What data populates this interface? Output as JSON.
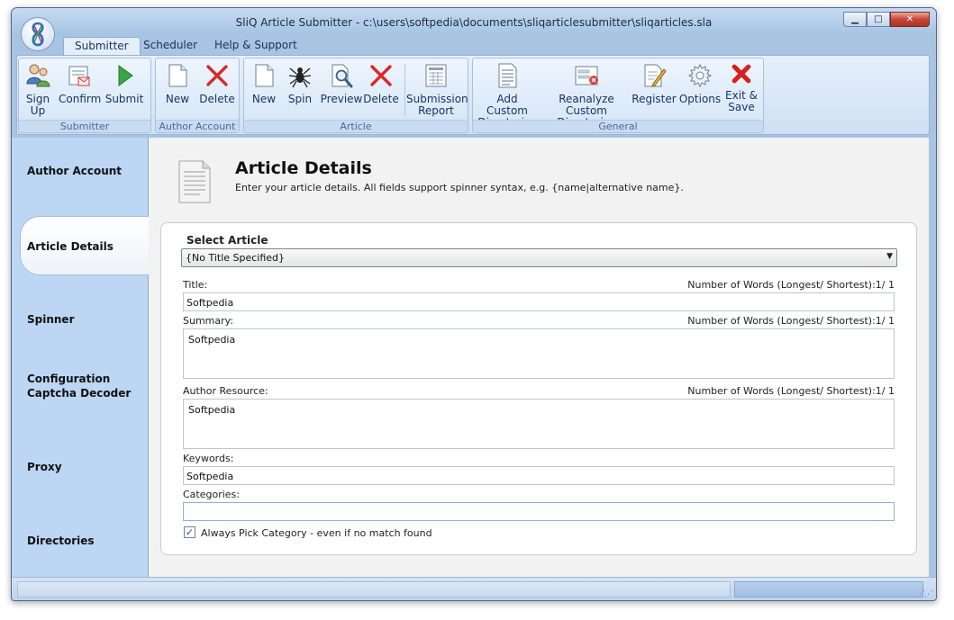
{
  "window": {
    "title": "SliQ Article Submitter - c:\\users\\softpedia\\documents\\sliqarticlesubmitter\\sliqarticles.sla",
    "min_glyph": "▁",
    "max_glyph": "□",
    "close_glyph": "✕"
  },
  "tabs": [
    {
      "label": "Submitter"
    },
    {
      "label": "Scheduler"
    },
    {
      "label": "Help & Support"
    }
  ],
  "ribbon": {
    "groups": {
      "submitter": {
        "label": "Submitter",
        "sign_up_1": "Sign",
        "sign_up_2": "Up",
        "confirm": "Confirm",
        "submit": "Submit"
      },
      "author_account": {
        "label": "Author Account",
        "new": "New",
        "delete": "Delete"
      },
      "article": {
        "label": "Article",
        "new": "New",
        "spin": "Spin",
        "preview": "Preview",
        "delete": "Delete",
        "report_1": "Submission",
        "report_2": "Report"
      },
      "general": {
        "label": "General",
        "add_dirs_1": "Add Custom",
        "add_dirs_2": "Directories",
        "reanalyze_1": "Reanalyze Custom",
        "reanalyze_2": "Directories",
        "register": "Register",
        "options": "Options",
        "exit_1": "Exit &",
        "exit_2": "Save"
      }
    }
  },
  "sidebar": {
    "items": [
      {
        "label": "Author Account"
      },
      {
        "label": "Article Details"
      },
      {
        "label": "Spinner Configuration"
      },
      {
        "label": "Captcha Decoder"
      },
      {
        "label": "Proxy"
      },
      {
        "label": "Directories"
      }
    ]
  },
  "main": {
    "title": "Article Details",
    "description": "Enter your article details. All fields support spinner syntax, e.g. {name|alternative name}.",
    "select_article": {
      "label": "Select Article",
      "value": "{No Title Specified}",
      "arrow": "▼"
    },
    "title_field": {
      "label": "Title:",
      "value": "Softpedia",
      "word_count": "Number of Words (Longest/ Shortest):1/ 1"
    },
    "summary": {
      "label": "Summary:",
      "value": "Softpedia",
      "word_count": "Number of Words (Longest/ Shortest):1/ 1"
    },
    "author_resource": {
      "label": "Author Resource:",
      "value": "Softpedia",
      "word_count": "Number of Words (Longest/ Shortest):1/ 1"
    },
    "keywords": {
      "label": "Keywords:",
      "value": "Softpedia"
    },
    "categories": {
      "label": "Categories:",
      "value": ""
    },
    "always_pick": {
      "label": "Always Pick Category - even if no match found",
      "checked": true,
      "mark": "✓"
    }
  },
  "status": {
    "grip": "⋰⋰"
  }
}
